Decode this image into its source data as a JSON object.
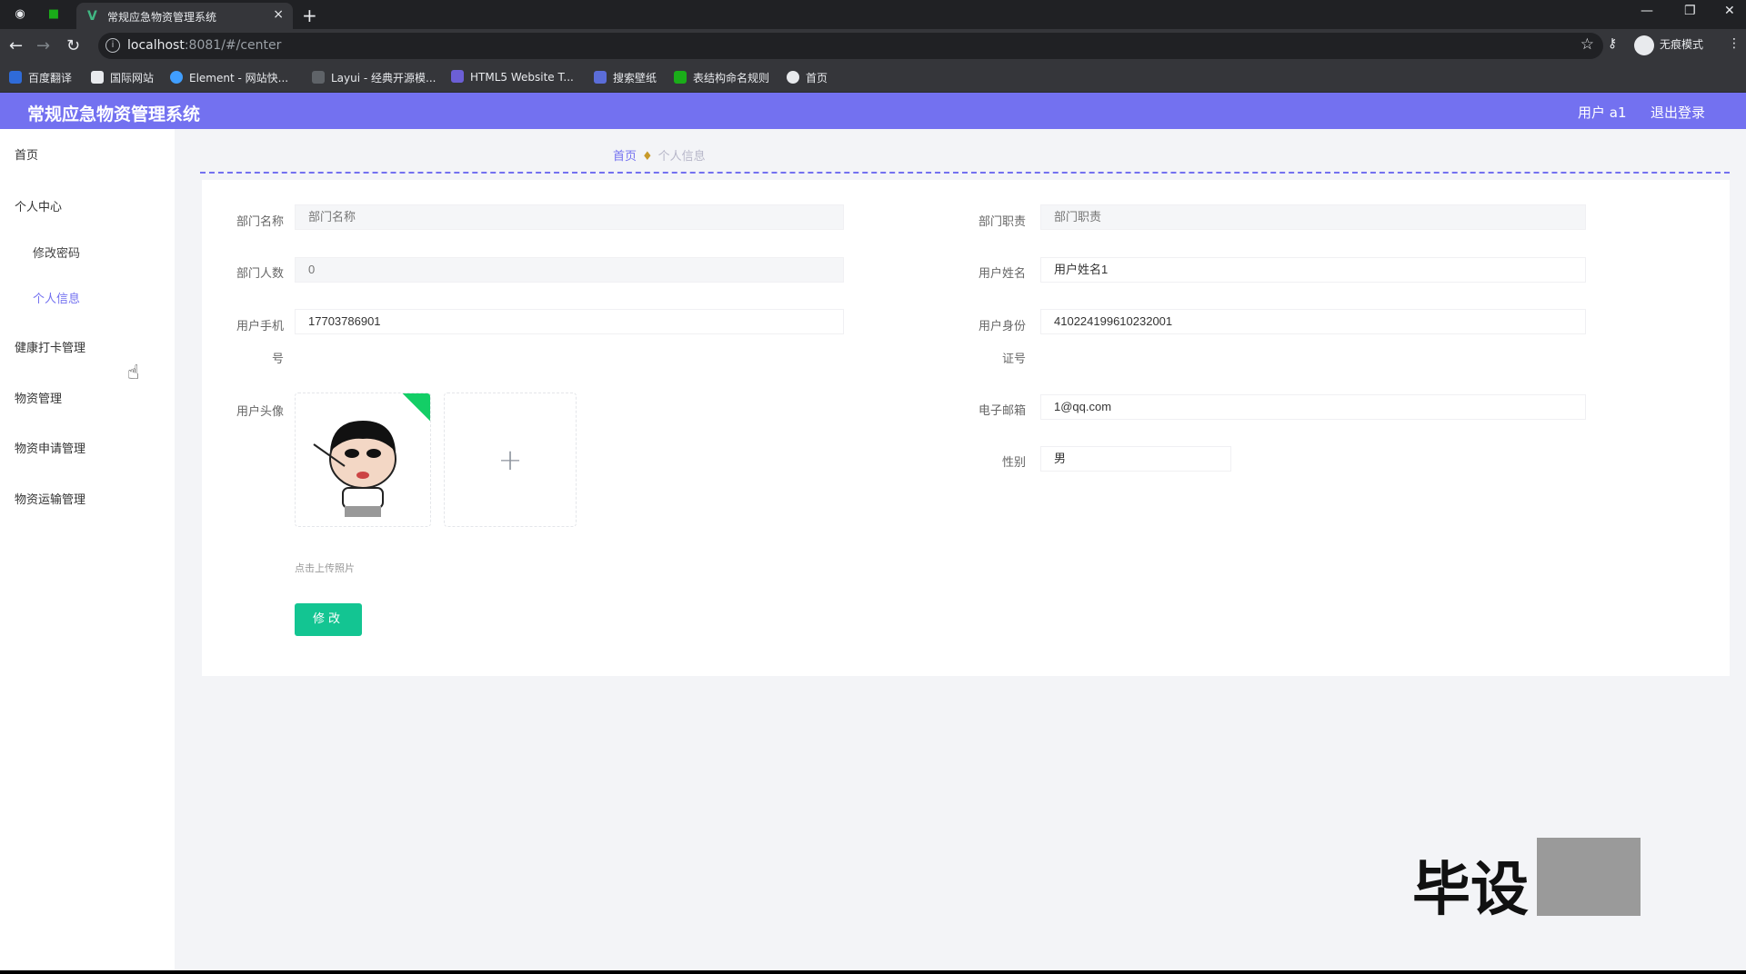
{
  "browser": {
    "tab_title": "常规应急物资管理系统",
    "tab_favicon": "V",
    "close_symbol": "×",
    "newtab_symbol": "+",
    "url_host": "localhost",
    "url_rest": ":8081/#/center",
    "incognito_label": "无痕模式",
    "bookmarks": [
      {
        "label": "百度翻译",
        "color": "#2f6bd8"
      },
      {
        "label": "国际网站",
        "color": "#e8eaed"
      },
      {
        "label": "Element - 网站快...",
        "color": "#409eff"
      },
      {
        "label": "Layui - 经典开源模...",
        "color": "#2f363c"
      },
      {
        "label": "HTML5 Website T...",
        "color": "#6c5fd6"
      },
      {
        "label": "搜索壁纸",
        "color": "#5b6dd8"
      },
      {
        "label": "表结构命名规则",
        "color": "#1aad19"
      },
      {
        "label": "首页",
        "color": "#e8eaed"
      }
    ]
  },
  "app": {
    "title": "常规应急物资管理系统",
    "user_label": "用户 a1",
    "logout_label": "退出登录",
    "accent_color": "#7371f0"
  },
  "sidebar": {
    "items": [
      {
        "label": "首页"
      },
      {
        "label": "个人中心"
      },
      {
        "label": "修改密码"
      },
      {
        "label": "个人信息"
      },
      {
        "label": "健康打卡管理"
      },
      {
        "label": "物资管理"
      },
      {
        "label": "物资申请管理"
      },
      {
        "label": "物资运输管理"
      }
    ]
  },
  "breadcrumb": {
    "home": "首页",
    "current": "个人信息"
  },
  "form": {
    "dept_name": {
      "label": "部门名称",
      "placeholder": "部门名称"
    },
    "dept_duty": {
      "label": "部门职责",
      "placeholder": "部门职责"
    },
    "dept_count": {
      "label": "部门人数",
      "placeholder": "0"
    },
    "user_name": {
      "label": "用户姓名",
      "value": "用户姓名1"
    },
    "user_phone": {
      "label1": "用户手机",
      "label2": "号",
      "value": "17703786901"
    },
    "user_id": {
      "label1": "用户身份",
      "label2": "证号",
      "value": "410224199610232001"
    },
    "avatar": {
      "label": "用户头像",
      "hint": "点击上传照片",
      "add_symbol": "+"
    },
    "email": {
      "label": "电子邮箱",
      "value": "1@qq.com"
    },
    "gender": {
      "label": "性别",
      "value": "男"
    },
    "submit_label": "修改"
  },
  "watermark": {
    "text": "毕设"
  }
}
